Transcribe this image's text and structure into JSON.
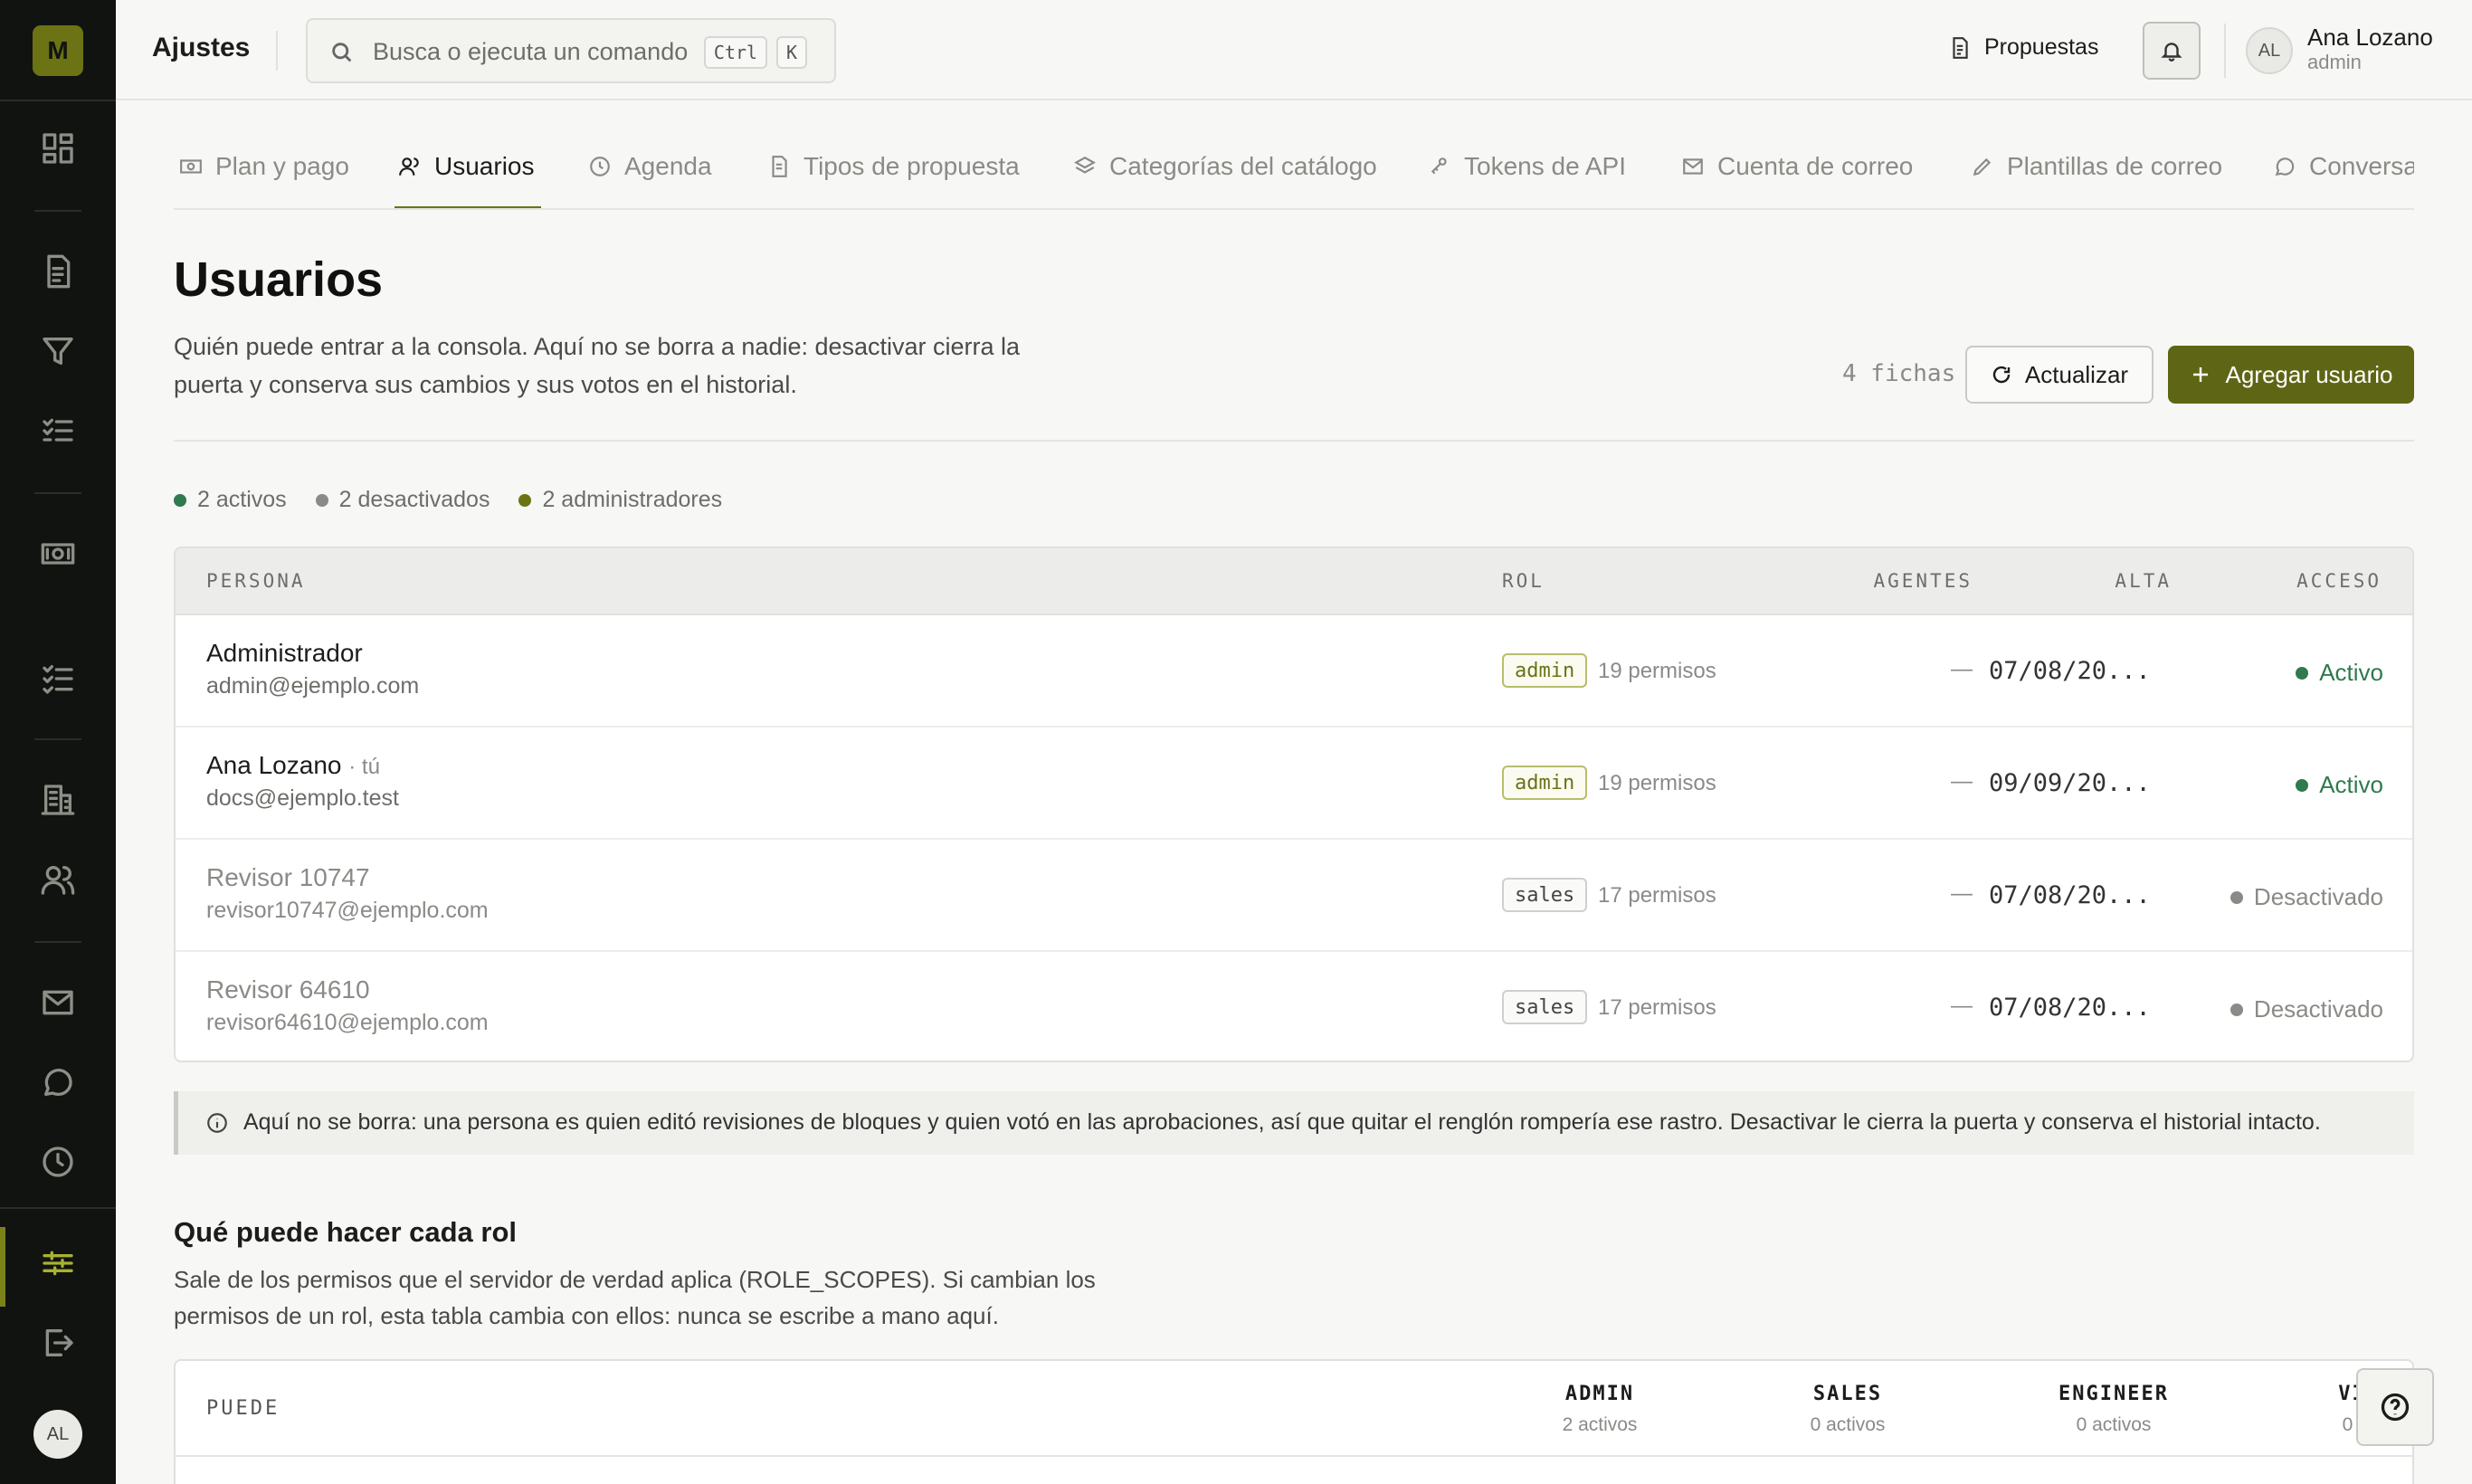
{
  "app": {
    "logo_letter": "M"
  },
  "topbar": {
    "title": "Ajustes",
    "search_placeholder": "Busca o ejecuta un comando",
    "kbd_ctrl": "Ctrl",
    "kbd_k": "K",
    "proposals_link": "Propuestas",
    "user": {
      "initials": "AL",
      "name": "Ana Lozano",
      "role": "admin"
    }
  },
  "sidebar": {
    "items": [
      "dashboard-icon",
      "document-icon",
      "filter-icon",
      "checklist-icon",
      "money-icon",
      "tasks-icon",
      "building-icon",
      "users-icon",
      "mail-icon",
      "chat-icon",
      "clock-icon",
      "settings-icon",
      "logout-icon"
    ],
    "active": "settings-icon",
    "avatar": "AL"
  },
  "tabs": [
    {
      "label": "Plan y pago",
      "icon": "money-icon"
    },
    {
      "label": "Usuarios",
      "icon": "users-icon",
      "active": true
    },
    {
      "label": "Agenda",
      "icon": "clock-icon"
    },
    {
      "label": "Tipos de propuesta",
      "icon": "document-icon"
    },
    {
      "label": "Categorías del catálogo",
      "icon": "layers-icon"
    },
    {
      "label": "Tokens de API",
      "icon": "key-icon"
    },
    {
      "label": "Cuenta de correo",
      "icon": "mail-icon"
    },
    {
      "label": "Plantillas de correo",
      "icon": "pencil-icon"
    },
    {
      "label": "Conversa",
      "icon": "chat-icon"
    }
  ],
  "page": {
    "title": "Usuarios",
    "description": "Quién puede entrar a la consola. Aquí no se borra a nadie: desactivar cierra la puerta y conserva sus cambios y sus votos en el historial.",
    "count": "4 fichas",
    "refresh_label": "Actualizar",
    "add_label": "Agregar usuario"
  },
  "stats": [
    {
      "label": "2 activos",
      "color": "#2f7a4e"
    },
    {
      "label": "2 desactivados",
      "color": "#8a8b86"
    },
    {
      "label": "2 administradores",
      "color": "#6b7314"
    }
  ],
  "table": {
    "headers": {
      "persona": "PERSONA",
      "rol": "ROL",
      "agentes": "AGENTES",
      "alta": "ALTA",
      "acceso": "ACCESO"
    },
    "rows": [
      {
        "name": "Administrador",
        "you": "",
        "email": "admin@ejemplo.com",
        "role": "admin",
        "perms": "19 permisos",
        "agents": "—",
        "alta": "07/08/20...",
        "access": "Activo",
        "active": true
      },
      {
        "name": "Ana Lozano",
        "you": "· tú",
        "email": "docs@ejemplo.test",
        "role": "admin",
        "perms": "19 permisos",
        "agents": "—",
        "alta": "09/09/20...",
        "access": "Activo",
        "active": true
      },
      {
        "name": "Revisor 10747",
        "you": "",
        "email": "revisor10747@ejemplo.com",
        "role": "sales",
        "perms": "17 permisos",
        "agents": "—",
        "alta": "07/08/20...",
        "access": "Desactivado",
        "active": false
      },
      {
        "name": "Revisor 64610",
        "you": "",
        "email": "revisor64610@ejemplo.com",
        "role": "sales",
        "perms": "17 permisos",
        "agents": "—",
        "alta": "07/08/20...",
        "access": "Desactivado",
        "active": false
      }
    ]
  },
  "note": "Aquí no se borra: una persona es quien editó revisiones de bloques y quien votó en las aprobaciones, así que quitar el renglón rompería ese rastro. Desactivar le cierra la puerta y conserva el historial intacto.",
  "roles_section": {
    "title": "Qué puede hacer cada rol",
    "description": "Sale de los permisos que el servidor de verdad aplica (ROLE_SCOPES). Si cambian los permisos de un rol, esta tabla cambia con ellos: nunca se escribe a mano aquí.",
    "puede": "PUEDE",
    "columns": [
      {
        "role": "ADMIN",
        "count": "2 activos"
      },
      {
        "role": "SALES",
        "count": "0 activos"
      },
      {
        "role": "ENGINEER",
        "count": "0 activos"
      },
      {
        "role": "VIEWER",
        "count": "0 activos"
      }
    ]
  }
}
